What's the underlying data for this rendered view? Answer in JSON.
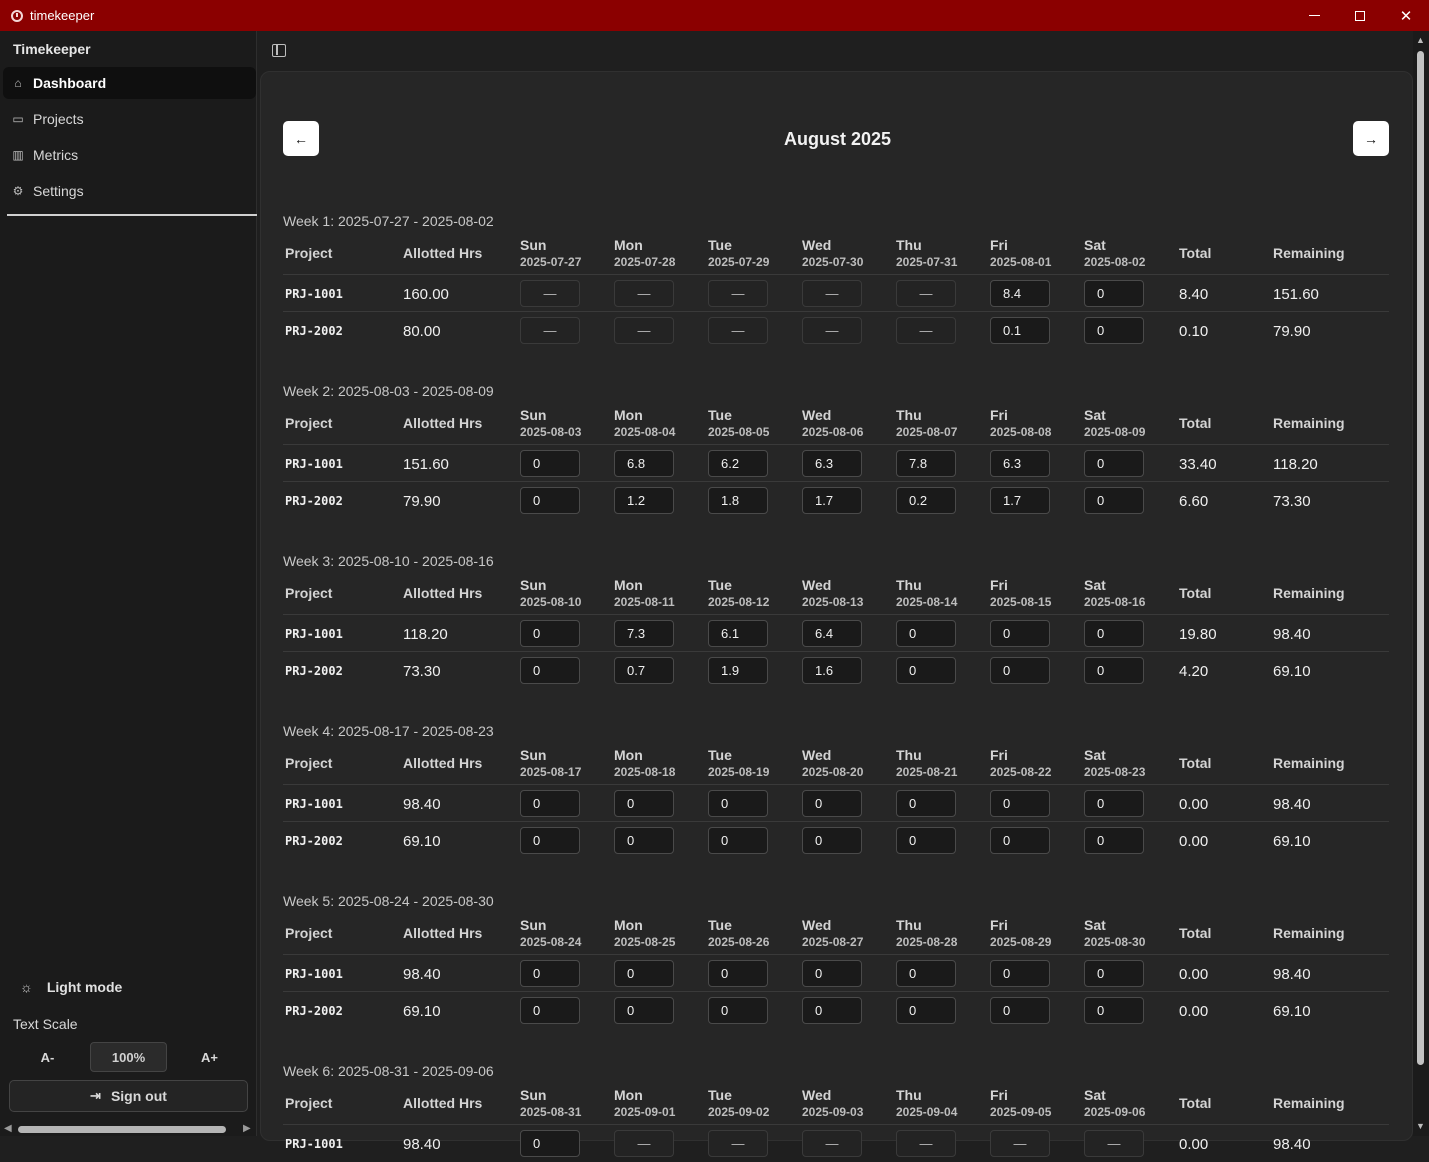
{
  "window": {
    "title": "timekeeper"
  },
  "sidebar": {
    "brand": "Timekeeper",
    "items": [
      {
        "label": "Dashboard",
        "icon": "home-icon",
        "active": true
      },
      {
        "label": "Projects",
        "icon": "folder-icon",
        "active": false
      },
      {
        "label": "Metrics",
        "icon": "bar-chart-icon",
        "active": false
      },
      {
        "label": "Settings",
        "icon": "gear-icon",
        "active": false
      }
    ],
    "light_mode_label": "Light mode",
    "text_scale_label": "Text Scale",
    "scale_decrease": "A-",
    "scale_value": "100%",
    "scale_increase": "A+",
    "sign_out_label": "Sign out"
  },
  "calendar": {
    "month_title": "August 2025",
    "prev_label": "←",
    "next_label": "→",
    "headers": {
      "project": "Project",
      "allotted": "Allotted Hrs",
      "total": "Total",
      "remaining": "Remaining"
    },
    "weeks": [
      {
        "title": "Week 1: 2025-07-27 - 2025-08-02",
        "days": [
          {
            "name": "Sun",
            "date": "2025-07-27"
          },
          {
            "name": "Mon",
            "date": "2025-07-28"
          },
          {
            "name": "Tue",
            "date": "2025-07-29"
          },
          {
            "name": "Wed",
            "date": "2025-07-30"
          },
          {
            "name": "Thu",
            "date": "2025-07-31"
          },
          {
            "name": "Fri",
            "date": "2025-08-01"
          },
          {
            "name": "Sat",
            "date": "2025-08-02"
          }
        ],
        "rows": [
          {
            "project": "PRJ-1001",
            "allotted": "160.00",
            "hours": [
              "—",
              "—",
              "—",
              "—",
              "—",
              "8.4",
              "0"
            ],
            "disabled": [
              true,
              true,
              true,
              true,
              true,
              false,
              false
            ],
            "total": "8.40",
            "remaining": "151.60"
          },
          {
            "project": "PRJ-2002",
            "allotted": "80.00",
            "hours": [
              "—",
              "—",
              "—",
              "—",
              "—",
              "0.1",
              "0"
            ],
            "disabled": [
              true,
              true,
              true,
              true,
              true,
              false,
              false
            ],
            "total": "0.10",
            "remaining": "79.90"
          }
        ]
      },
      {
        "title": "Week 2: 2025-08-03 - 2025-08-09",
        "days": [
          {
            "name": "Sun",
            "date": "2025-08-03"
          },
          {
            "name": "Mon",
            "date": "2025-08-04"
          },
          {
            "name": "Tue",
            "date": "2025-08-05"
          },
          {
            "name": "Wed",
            "date": "2025-08-06"
          },
          {
            "name": "Thu",
            "date": "2025-08-07"
          },
          {
            "name": "Fri",
            "date": "2025-08-08"
          },
          {
            "name": "Sat",
            "date": "2025-08-09"
          }
        ],
        "rows": [
          {
            "project": "PRJ-1001",
            "allotted": "151.60",
            "hours": [
              "0",
              "6.8",
              "6.2",
              "6.3",
              "7.8",
              "6.3",
              "0"
            ],
            "disabled": [
              false,
              false,
              false,
              false,
              false,
              false,
              false
            ],
            "total": "33.40",
            "remaining": "118.20"
          },
          {
            "project": "PRJ-2002",
            "allotted": "79.90",
            "hours": [
              "0",
              "1.2",
              "1.8",
              "1.7",
              "0.2",
              "1.7",
              "0"
            ],
            "disabled": [
              false,
              false,
              false,
              false,
              false,
              false,
              false
            ],
            "total": "6.60",
            "remaining": "73.30"
          }
        ]
      },
      {
        "title": "Week 3: 2025-08-10 - 2025-08-16",
        "days": [
          {
            "name": "Sun",
            "date": "2025-08-10"
          },
          {
            "name": "Mon",
            "date": "2025-08-11"
          },
          {
            "name": "Tue",
            "date": "2025-08-12"
          },
          {
            "name": "Wed",
            "date": "2025-08-13"
          },
          {
            "name": "Thu",
            "date": "2025-08-14"
          },
          {
            "name": "Fri",
            "date": "2025-08-15"
          },
          {
            "name": "Sat",
            "date": "2025-08-16"
          }
        ],
        "rows": [
          {
            "project": "PRJ-1001",
            "allotted": "118.20",
            "hours": [
              "0",
              "7.3",
              "6.1",
              "6.4",
              "0",
              "0",
              "0"
            ],
            "disabled": [
              false,
              false,
              false,
              false,
              false,
              false,
              false
            ],
            "total": "19.80",
            "remaining": "98.40"
          },
          {
            "project": "PRJ-2002",
            "allotted": "73.30",
            "hours": [
              "0",
              "0.7",
              "1.9",
              "1.6",
              "0",
              "0",
              "0"
            ],
            "disabled": [
              false,
              false,
              false,
              false,
              false,
              false,
              false
            ],
            "total": "4.20",
            "remaining": "69.10"
          }
        ]
      },
      {
        "title": "Week 4: 2025-08-17 - 2025-08-23",
        "days": [
          {
            "name": "Sun",
            "date": "2025-08-17"
          },
          {
            "name": "Mon",
            "date": "2025-08-18"
          },
          {
            "name": "Tue",
            "date": "2025-08-19"
          },
          {
            "name": "Wed",
            "date": "2025-08-20"
          },
          {
            "name": "Thu",
            "date": "2025-08-21"
          },
          {
            "name": "Fri",
            "date": "2025-08-22"
          },
          {
            "name": "Sat",
            "date": "2025-08-23"
          }
        ],
        "rows": [
          {
            "project": "PRJ-1001",
            "allotted": "98.40",
            "hours": [
              "0",
              "0",
              "0",
              "0",
              "0",
              "0",
              "0"
            ],
            "disabled": [
              false,
              false,
              false,
              false,
              false,
              false,
              false
            ],
            "total": "0.00",
            "remaining": "98.40"
          },
          {
            "project": "PRJ-2002",
            "allotted": "69.10",
            "hours": [
              "0",
              "0",
              "0",
              "0",
              "0",
              "0",
              "0"
            ],
            "disabled": [
              false,
              false,
              false,
              false,
              false,
              false,
              false
            ],
            "total": "0.00",
            "remaining": "69.10"
          }
        ]
      },
      {
        "title": "Week 5: 2025-08-24 - 2025-08-30",
        "days": [
          {
            "name": "Sun",
            "date": "2025-08-24"
          },
          {
            "name": "Mon",
            "date": "2025-08-25"
          },
          {
            "name": "Tue",
            "date": "2025-08-26"
          },
          {
            "name": "Wed",
            "date": "2025-08-27"
          },
          {
            "name": "Thu",
            "date": "2025-08-28"
          },
          {
            "name": "Fri",
            "date": "2025-08-29"
          },
          {
            "name": "Sat",
            "date": "2025-08-30"
          }
        ],
        "rows": [
          {
            "project": "PRJ-1001",
            "allotted": "98.40",
            "hours": [
              "0",
              "0",
              "0",
              "0",
              "0",
              "0",
              "0"
            ],
            "disabled": [
              false,
              false,
              false,
              false,
              false,
              false,
              false
            ],
            "total": "0.00",
            "remaining": "98.40"
          },
          {
            "project": "PRJ-2002",
            "allotted": "69.10",
            "hours": [
              "0",
              "0",
              "0",
              "0",
              "0",
              "0",
              "0"
            ],
            "disabled": [
              false,
              false,
              false,
              false,
              false,
              false,
              false
            ],
            "total": "0.00",
            "remaining": "69.10"
          }
        ]
      },
      {
        "title": "Week 6: 2025-08-31 - 2025-09-06",
        "days": [
          {
            "name": "Sun",
            "date": "2025-08-31"
          },
          {
            "name": "Mon",
            "date": "2025-09-01"
          },
          {
            "name": "Tue",
            "date": "2025-09-02"
          },
          {
            "name": "Wed",
            "date": "2025-09-03"
          },
          {
            "name": "Thu",
            "date": "2025-09-04"
          },
          {
            "name": "Fri",
            "date": "2025-09-05"
          },
          {
            "name": "Sat",
            "date": "2025-09-06"
          }
        ],
        "rows": [
          {
            "project": "PRJ-1001",
            "allotted": "98.40",
            "hours": [
              "0",
              "—",
              "—",
              "—",
              "—",
              "—",
              "—"
            ],
            "disabled": [
              false,
              true,
              true,
              true,
              true,
              true,
              true
            ],
            "total": "0.00",
            "remaining": "98.40"
          }
        ]
      }
    ]
  }
}
